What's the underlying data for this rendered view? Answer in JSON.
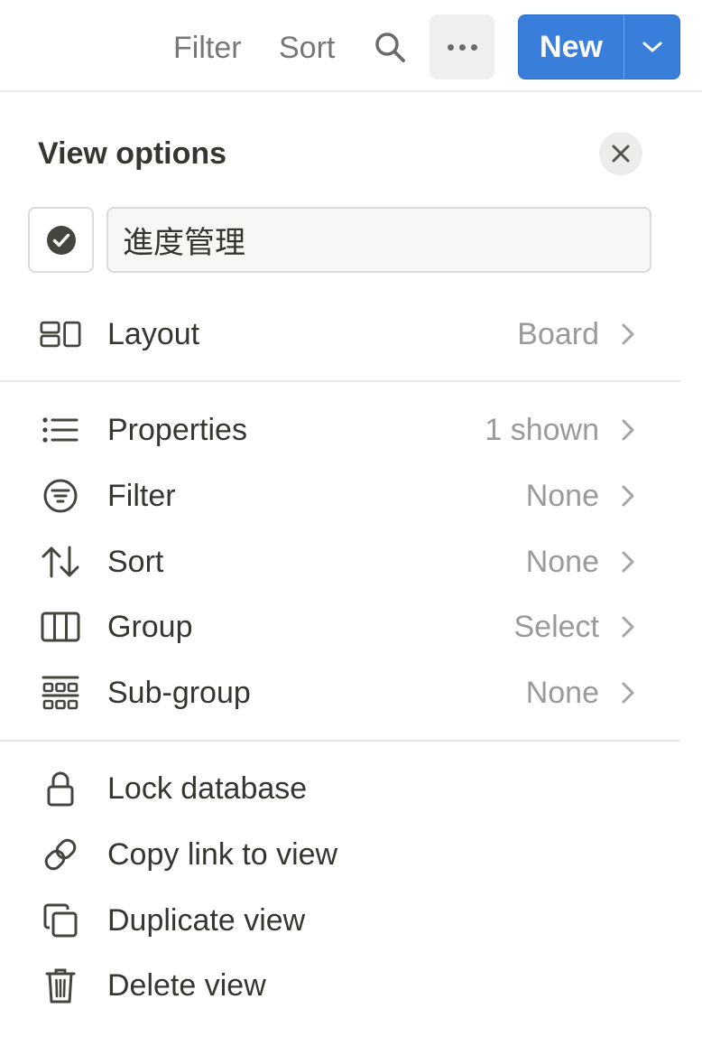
{
  "toolbar": {
    "filter_label": "Filter",
    "sort_label": "Sort",
    "search_icon": "search-icon",
    "more_icon": "more-horizontal-icon",
    "new_label": "New",
    "new_caret_icon": "chevron-down-icon",
    "accent_color": "#3a7edb"
  },
  "panel": {
    "title": "View options",
    "close_icon": "close-icon",
    "view_icon": "check-circle-icon",
    "view_name": "進度管理",
    "layout": {
      "icon": "layout-board-icon",
      "label": "Layout",
      "value": "Board"
    },
    "settings": [
      {
        "icon": "list-icon",
        "label": "Properties",
        "value": "1 shown"
      },
      {
        "icon": "filter-icon",
        "label": "Filter",
        "value": "None"
      },
      {
        "icon": "sort-arrows-icon",
        "label": "Sort",
        "value": "None"
      },
      {
        "icon": "group-columns-icon",
        "label": "Group",
        "value": "Select"
      },
      {
        "icon": "sub-group-grid-icon",
        "label": "Sub-group",
        "value": "None"
      }
    ],
    "actions": [
      {
        "icon": "lock-icon",
        "label": "Lock database"
      },
      {
        "icon": "link-icon",
        "label": "Copy link to view"
      },
      {
        "icon": "duplicate-icon",
        "label": "Duplicate view"
      },
      {
        "icon": "trash-icon",
        "label": "Delete view"
      }
    ]
  }
}
